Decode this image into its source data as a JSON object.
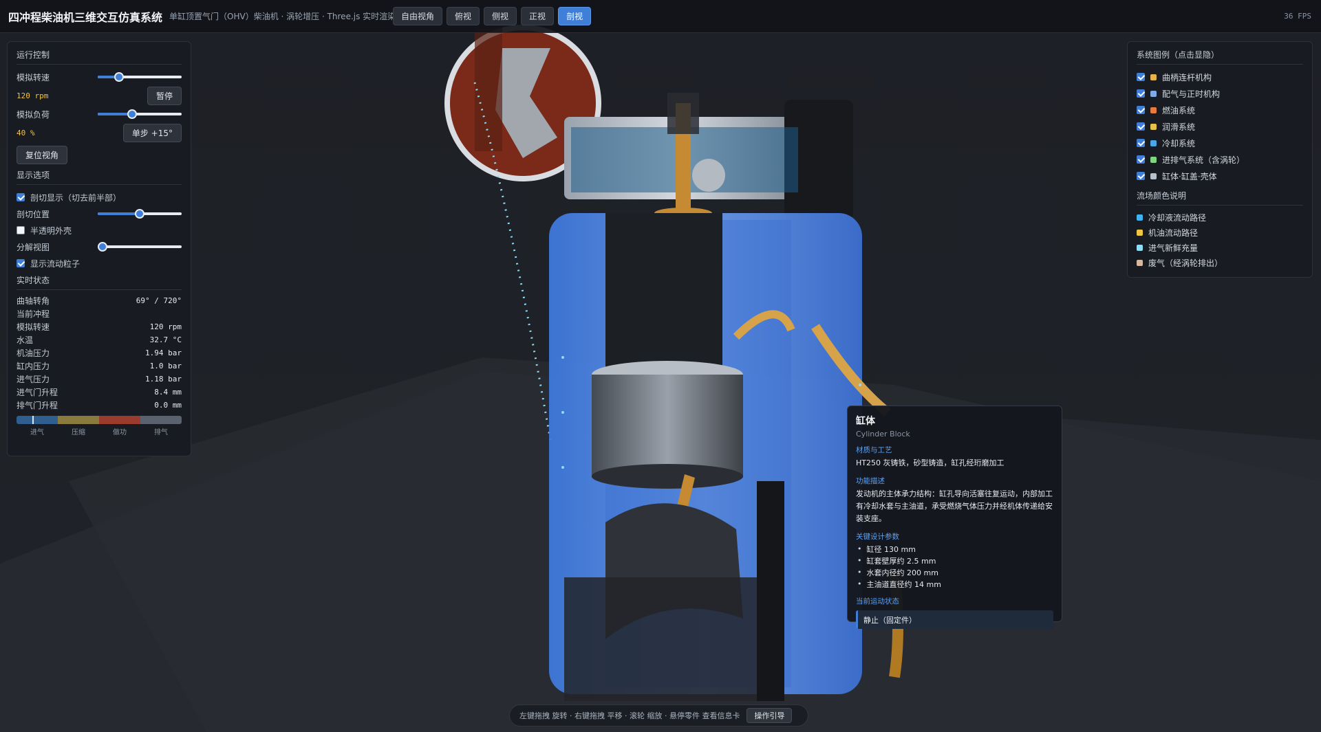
{
  "header": {
    "title": "四冲程柴油机三维交互仿真系统",
    "subtitle": "单缸顶置气门（OHV）柴油机 · 涡轮增压 · Three.js 实时渲染",
    "view_buttons": [
      "自由视角",
      "俯视",
      "侧视",
      "正视",
      "剖视"
    ],
    "active_view": "剖视",
    "fps": "36 FPS"
  },
  "control_panel": {
    "title": "运行控制",
    "speed_label": "模拟转速",
    "speed_value": "120 rpm",
    "speed_slider_fraction": 0.22,
    "pause_button": "暂停",
    "load_label": "模拟负荷",
    "load_value": "40 %",
    "load_slider_fraction": 0.4,
    "step_button": "单步 +15°",
    "reset_view_button": "复位视角"
  },
  "display_options": {
    "title": "显示选项",
    "cutaway_label": "剖切显示（切去前半部）",
    "cutaway_checked": true,
    "cut_position_label": "剖切位置",
    "cut_position_fraction": 0.5,
    "translucent_label": "半透明外壳",
    "translucent_checked": false,
    "explode_label": "分解视图",
    "explode_fraction": 0.0,
    "particles_label": "显示流动粒子",
    "particles_checked": true
  },
  "status": {
    "title": "实时状态",
    "rows": [
      {
        "label": "曲轴转角",
        "value": "69° / 720°"
      },
      {
        "label": "当前冲程",
        "value": ""
      },
      {
        "label": "模拟转速",
        "value": "120 rpm"
      },
      {
        "label": "水温",
        "value": "32.7 °C"
      },
      {
        "label": "机油压力",
        "value": "1.94 bar"
      },
      {
        "label": "缸内压力",
        "value": "1.0 bar"
      },
      {
        "label": "进气压力",
        "value": "1.18 bar"
      },
      {
        "label": "进气门升程",
        "value": "8.4 mm"
      },
      {
        "label": "排气门升程",
        "value": "0.0 mm"
      }
    ],
    "stroke_labels": [
      "进气",
      "压缩",
      "做功",
      "排气"
    ],
    "stroke_colors": [
      "#2e5f8f",
      "#8a7a3e",
      "#9a3b2e",
      "#5a6270"
    ],
    "cycle_fraction": 0.096
  },
  "legend": {
    "title": "系统图例（点击显隐）",
    "items": [
      {
        "label": "曲柄连杆机构",
        "color": "#e8b24a",
        "checked": true
      },
      {
        "label": "配气与正时机构",
        "color": "#7fa8e8",
        "checked": true
      },
      {
        "label": "燃油系统",
        "color": "#e87a3e",
        "checked": true
      },
      {
        "label": "润滑系统",
        "color": "#e6c04a",
        "checked": true
      },
      {
        "label": "冷却系统",
        "color": "#4aa8e8",
        "checked": true
      },
      {
        "label": "进排气系统（含涡轮）",
        "color": "#7ed67e",
        "checked": true
      },
      {
        "label": "缸体·缸盖·壳体",
        "color": "#b8c0cc",
        "checked": true
      }
    ],
    "flow_title": "流场颜色说明",
    "flow_items": [
      {
        "label": "冷却液流动路径",
        "color": "#3fb4f0"
      },
      {
        "label": "机油流动路径",
        "color": "#f0c63f"
      },
      {
        "label": "进气新鲜充量",
        "color": "#8fdcf5"
      },
      {
        "label": "废气（经涡轮排出）",
        "color": "#d6b8a0"
      }
    ]
  },
  "info_card": {
    "title": "缸体",
    "subtitle": "Cylinder Block",
    "material_head": "材质与工艺",
    "material_text": "HT250 灰铸铁，砂型铸造，缸孔经珩磨加工",
    "function_head": "功能描述",
    "function_text": "发动机的主体承力结构：缸孔导向活塞往复运动，内部加工有冷却水套与主油道，承受燃烧气体压力并经机体传递给安装支座。",
    "params_head": "关键设计参数",
    "params": [
      "缸径 130 mm",
      "缸套壁厚约 2.5 mm",
      "水套内径约 200 mm",
      "主油道直径约 14 mm"
    ],
    "state_head": "当前运动状态",
    "state_text": "静止（固定件）"
  },
  "hint": {
    "text": "左键拖拽 旋转 · 右键拖拽 平移 · 滚轮 缩放 · 悬停零件 查看信息卡",
    "guide_button": "操作引导"
  }
}
